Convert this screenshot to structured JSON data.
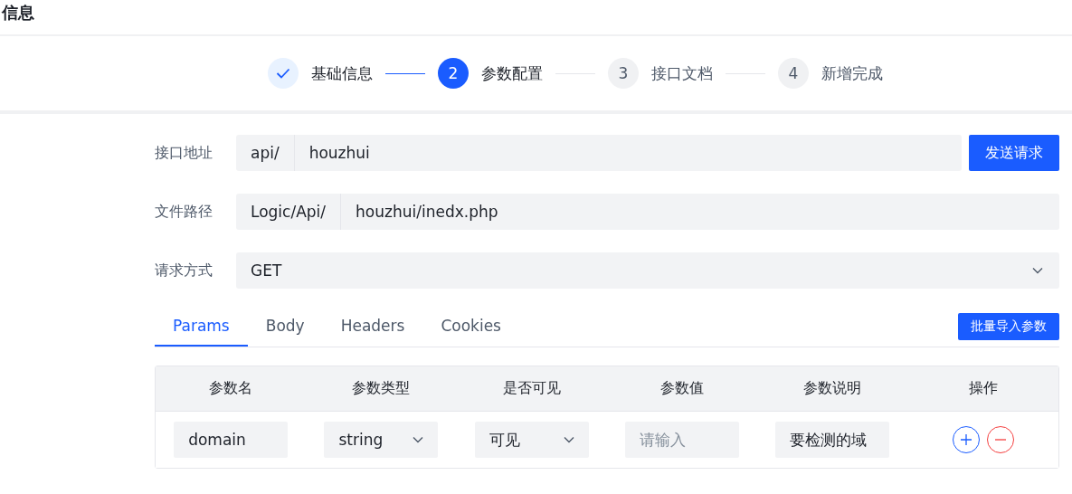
{
  "page_title": "信息",
  "steps": [
    {
      "label": "基础信息",
      "completed": true,
      "selected": false
    },
    {
      "number": "2",
      "label": "参数配置",
      "completed": false,
      "selected": true
    },
    {
      "number": "3",
      "label": "接口文档",
      "completed": false,
      "selected": false
    },
    {
      "number": "4",
      "label": "新增完成",
      "completed": false,
      "selected": false
    }
  ],
  "form": {
    "api_address": {
      "label": "接口地址",
      "prefix": "api/",
      "value": "houzhui",
      "button": "发送请求"
    },
    "file_path": {
      "label": "文件路径",
      "prefix": "Logic/Api/",
      "value": "houzhui/inedx.php"
    },
    "method": {
      "label": "请求方式",
      "value": "GET"
    }
  },
  "tabs": [
    {
      "label": "Params",
      "selected": true
    },
    {
      "label": "Body",
      "selected": false
    },
    {
      "label": "Headers",
      "selected": false
    },
    {
      "label": "Cookies",
      "selected": false
    }
  ],
  "import_button": "批量导入参数",
  "table": {
    "columns": [
      "参数名",
      "参数类型",
      "是否可见",
      "参数值",
      "参数说明",
      "操作"
    ],
    "rows": [
      {
        "name": "domain",
        "type": "string",
        "visible": "可见",
        "value_placeholder": "请输入",
        "description": "要检测的域"
      }
    ]
  }
}
